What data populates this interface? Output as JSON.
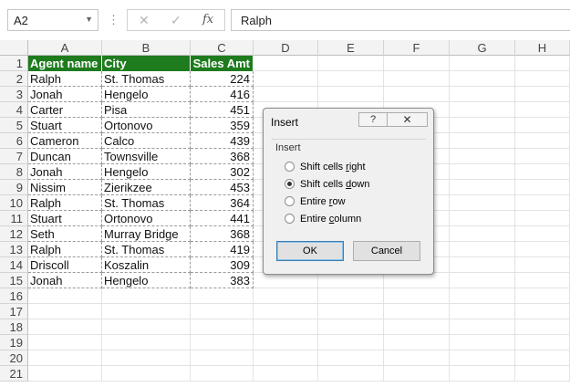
{
  "formula_bar": {
    "name_box": "A2",
    "name_box_dropdown": "▼",
    "more_icon": "⋮",
    "cancel_symbol": "✕",
    "enter_symbol": "✓",
    "fx_symbol": "fx",
    "formula_value": "Ralph"
  },
  "columns": [
    "A",
    "B",
    "C",
    "D",
    "E",
    "F",
    "G",
    "H"
  ],
  "rows": [
    "1",
    "2",
    "3",
    "4",
    "5",
    "6",
    "7",
    "8",
    "9",
    "10",
    "11",
    "12",
    "13",
    "14",
    "15",
    "16",
    "17",
    "18",
    "19",
    "20",
    "21"
  ],
  "table": {
    "header": {
      "agent": "Agent name",
      "city": "City",
      "sales": "Sales Amt"
    },
    "header_color": "#1e7b1e",
    "records": [
      {
        "agent": "Ralph",
        "city": "St. Thomas",
        "sales": "224"
      },
      {
        "agent": "Jonah",
        "city": "Hengelo",
        "sales": "416"
      },
      {
        "agent": "Carter",
        "city": "Pisa",
        "sales": "451"
      },
      {
        "agent": "Stuart",
        "city": "Ortonovo",
        "sales": "359"
      },
      {
        "agent": "Cameron",
        "city": "Calco",
        "sales": "439"
      },
      {
        "agent": "Duncan",
        "city": "Townsville",
        "sales": "368"
      },
      {
        "agent": "Jonah",
        "city": "Hengelo",
        "sales": "302"
      },
      {
        "agent": "Nissim",
        "city": "Zierikzee",
        "sales": "453"
      },
      {
        "agent": "Ralph",
        "city": "St. Thomas",
        "sales": "364"
      },
      {
        "agent": "Stuart",
        "city": "Ortonovo",
        "sales": "441"
      },
      {
        "agent": "Seth",
        "city": "Murray Bridge",
        "sales": "368"
      },
      {
        "agent": "Ralph",
        "city": "St. Thomas",
        "sales": "419"
      },
      {
        "agent": "Driscoll",
        "city": "Koszalin",
        "sales": "309"
      },
      {
        "agent": "Jonah",
        "city": "Hengelo",
        "sales": "383"
      }
    ]
  },
  "dialog": {
    "title": "Insert",
    "help_symbol": "?",
    "close_symbol": "✕",
    "group_label": "Insert",
    "options": [
      {
        "pre": "Shift cells ",
        "u": "r",
        "post": "ight",
        "selected": false
      },
      {
        "pre": "Shift cells ",
        "u": "d",
        "post": "own",
        "selected": true
      },
      {
        "pre": "Entire ",
        "u": "r",
        "post": "ow",
        "selected": false
      },
      {
        "pre": "Entire ",
        "u": "c",
        "post": "olumn",
        "selected": false
      }
    ],
    "ok_label": "OK",
    "cancel_label": "Cancel"
  }
}
